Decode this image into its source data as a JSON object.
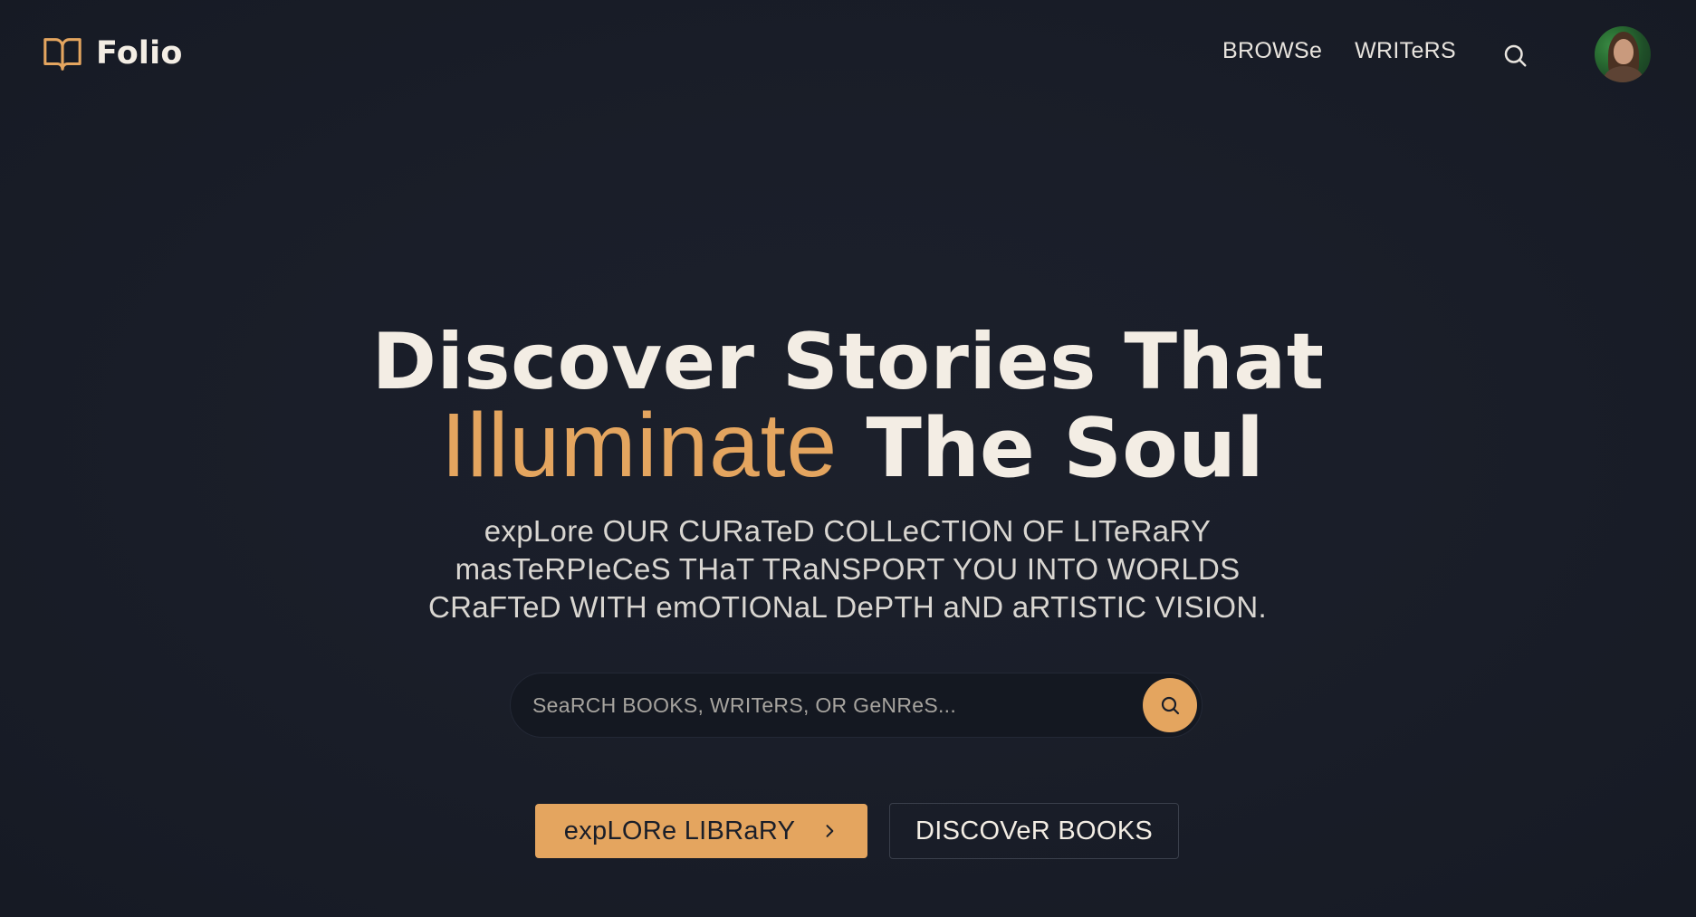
{
  "brand": {
    "name": "Folio",
    "icon": "open-book-icon",
    "accent_color": "#e4a55f"
  },
  "nav": {
    "links": [
      {
        "label": "BROWSe"
      },
      {
        "label": "WRITeRS"
      }
    ],
    "search_icon": "search-icon",
    "avatar": "user-avatar"
  },
  "hero": {
    "title_line1": "Discover Stories That",
    "title_accent": "Illuminate",
    "title_line2_rest": "The Soul",
    "description": "expLore OUR CURaTeD COLLeCTION OF LITeRaRY masTeRPIeCeS THaT TRaNSPORT YOU INTO WORLDS CRaFTeD WITH emOTIONaL DePTH aND aRTISTIC VISION."
  },
  "search": {
    "placeholder": "SeaRCH BOOKS, WRITeRS, OR GeNReS...",
    "value": ""
  },
  "actions": {
    "primary_label": "expLORe LIBRaRY",
    "secondary_label": "DISCOVeR BOOKS"
  },
  "colors": {
    "background": "#1a1e29",
    "text": "#f3ede4",
    "accent": "#e4a55f",
    "input_bg": "#141821"
  }
}
